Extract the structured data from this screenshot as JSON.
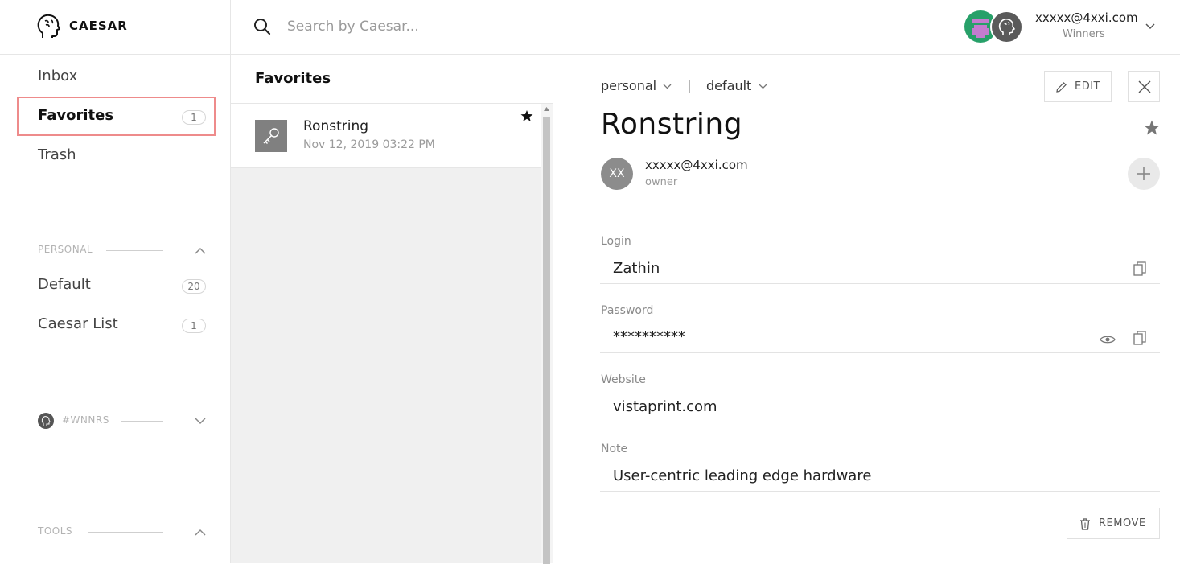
{
  "brand": {
    "name": "CAESAR",
    "logo_icon": "head-profile-icon"
  },
  "search": {
    "placeholder": "Search by Caesar..."
  },
  "account": {
    "email": "xxxxx@4xxi.com",
    "team": "Winners"
  },
  "sidebar": {
    "nav": [
      {
        "label": "Inbox"
      },
      {
        "label": "Favorites",
        "count": "1",
        "selected": true
      },
      {
        "label": "Trash"
      }
    ],
    "sections": [
      {
        "label": "PERSONAL",
        "expanded": true,
        "items": [
          {
            "label": "Default",
            "count": "20"
          },
          {
            "label": "Caesar List",
            "count": "1"
          }
        ]
      },
      {
        "label": "#WNNRS",
        "expanded": false
      },
      {
        "label": "TOOLS",
        "expanded": true
      }
    ]
  },
  "list": {
    "title": "Favorites",
    "items": [
      {
        "name": "Ronstring",
        "date": "Nov 12, 2019 03:22 PM",
        "icon": "key-icon",
        "starred": true
      }
    ]
  },
  "detail": {
    "breadcrumb": {
      "list": "personal",
      "separator": "|",
      "folder": "default"
    },
    "edit_label": "EDIT",
    "remove_label": "REMOVE",
    "title": "Ronstring",
    "owner": {
      "initials": "XX",
      "email": "xxxxx@4xxi.com",
      "role": "owner"
    },
    "fields": [
      {
        "label": "Login",
        "value": "Zathin"
      },
      {
        "label": "Password",
        "value": "**********"
      },
      {
        "label": "Website",
        "value": "vistaprint.com"
      },
      {
        "label": "Note",
        "value": "User-centric leading edge hardware"
      }
    ]
  },
  "colors": {
    "highlight_border": "#ee8b8b",
    "team_avatar": "#27a069",
    "key_tile": "#808080"
  }
}
